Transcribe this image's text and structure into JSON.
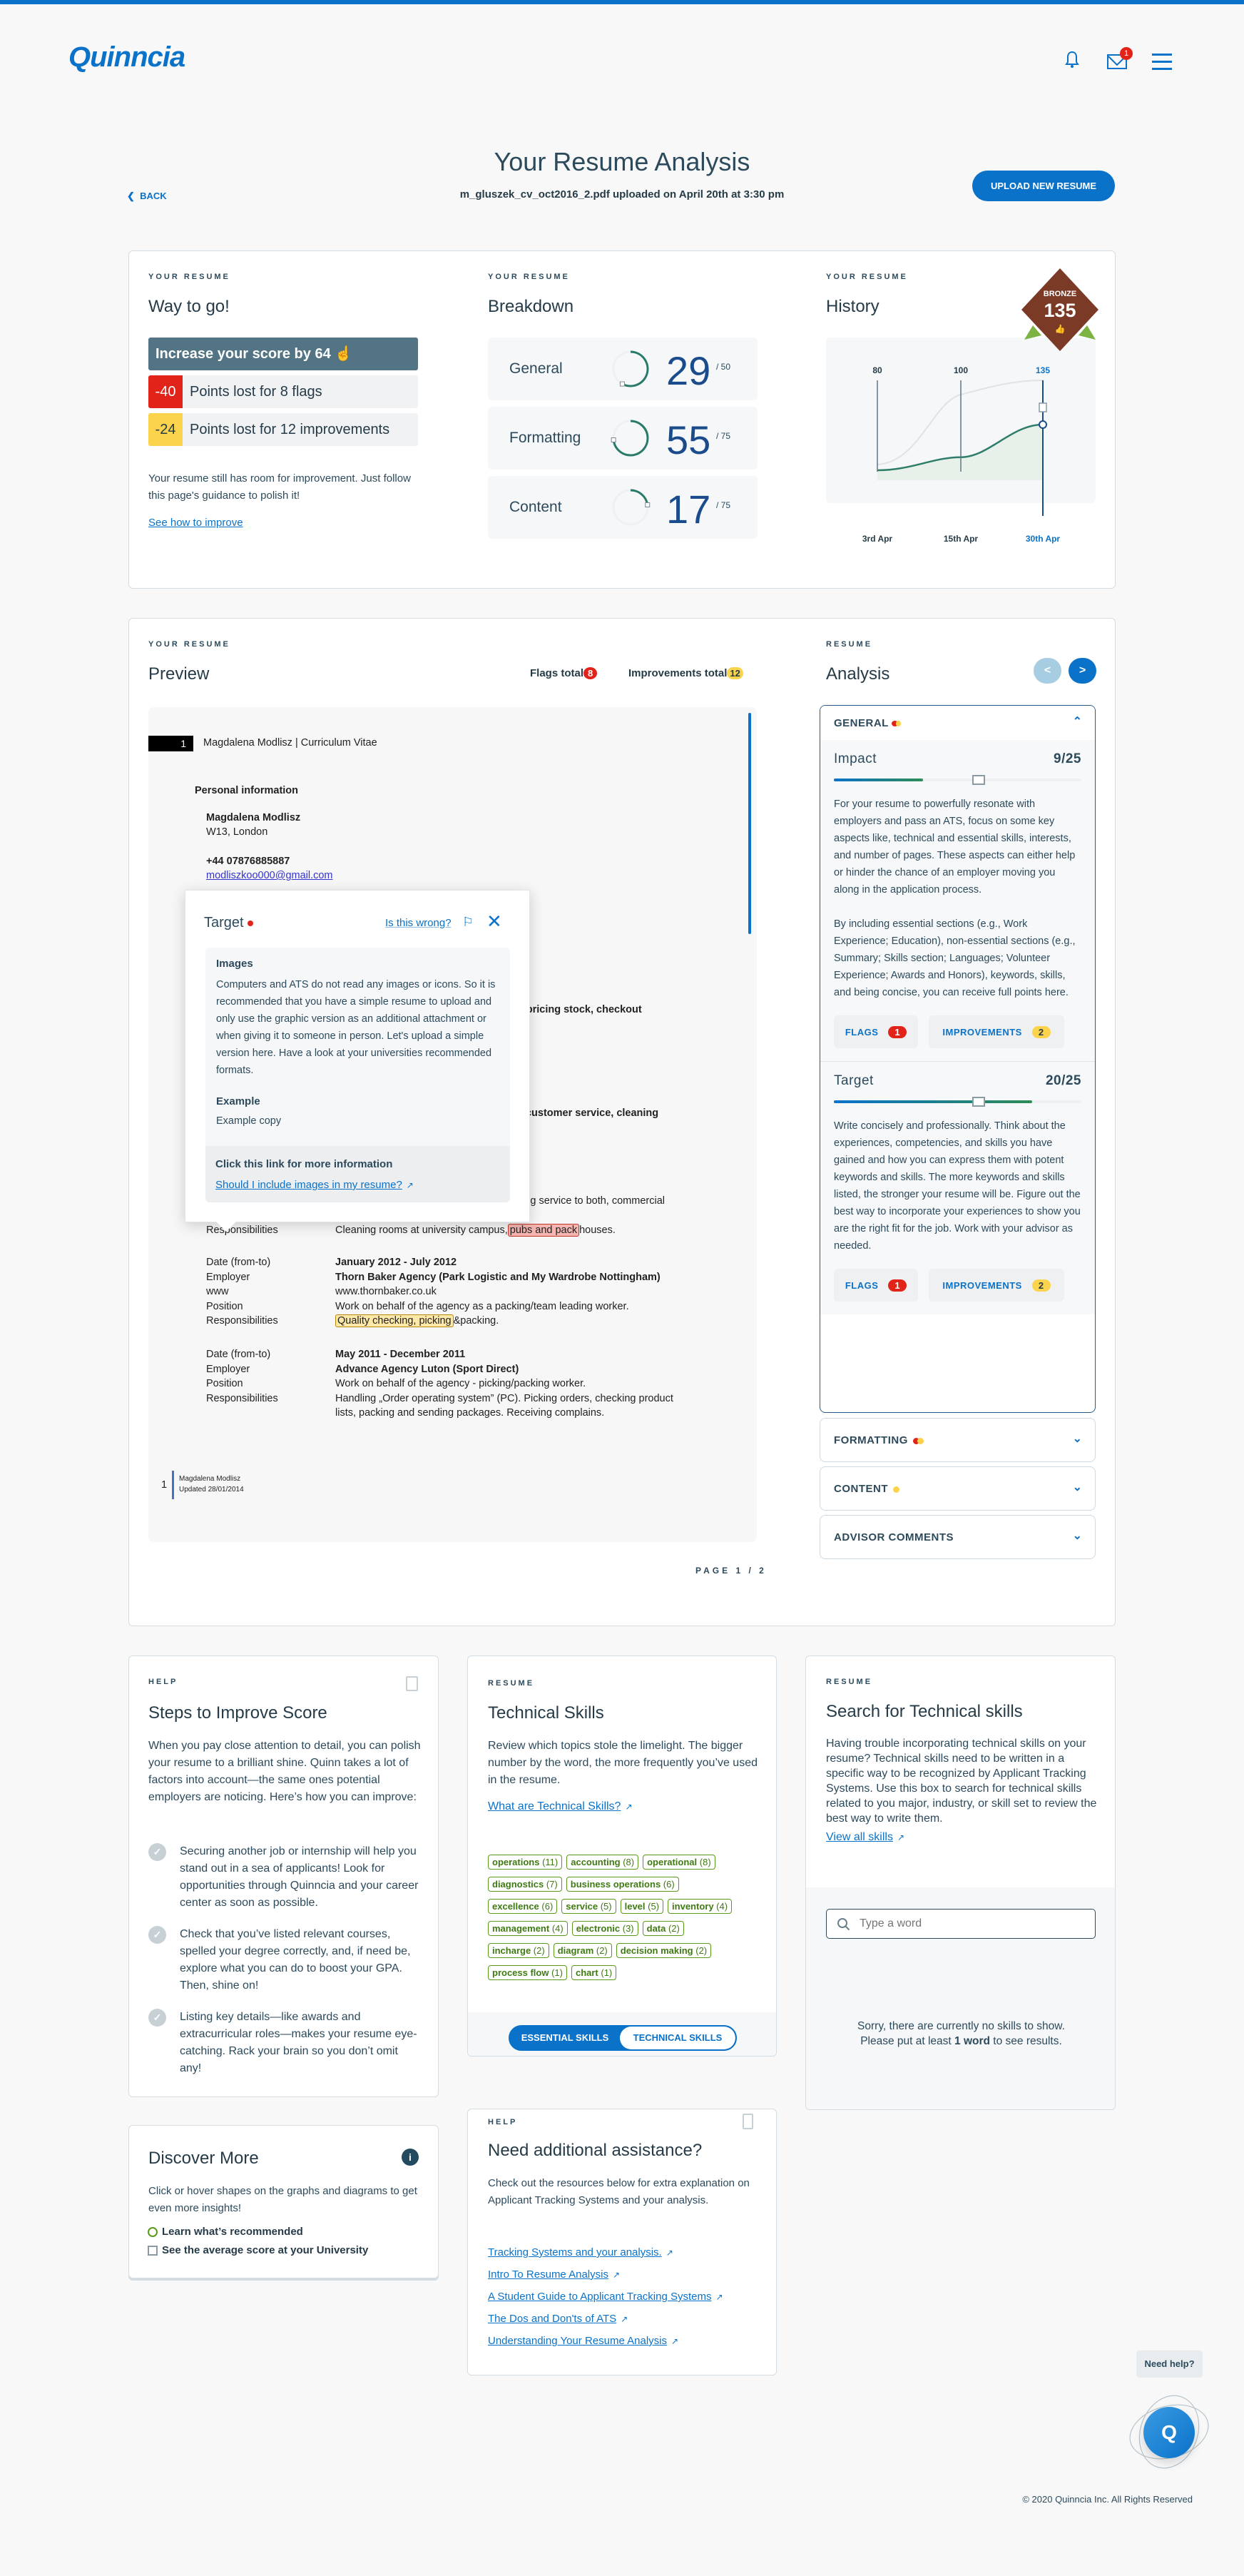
{
  "header": {
    "logo": "Quinncia",
    "mail_badge": "1"
  },
  "page": {
    "title": "Your Resume Analysis",
    "file_info": "m_gluszek_cv_oct2016_2.pdf uploaded on April 20th at 3:30 pm",
    "back_label": "BACK",
    "upload_label": "UPLOAD NEW RESUME"
  },
  "summary": {
    "way": {
      "label": "YOUR RESUME",
      "title": "Way to go!",
      "increase": "Increase your score by 64",
      "flags_points": "-40",
      "flags_text": "Points lost for 8 flags",
      "impr_points": "-24",
      "impr_text": "Points lost for 12 improvements",
      "note": "Your resume still has room for improvement. Just follow this page's guidance to polish it!",
      "link": "See how to improve"
    },
    "breakdown": {
      "label": "YOUR RESUME",
      "title": "Breakdown",
      "items": [
        {
          "name": "General",
          "score": 29,
          "max": 50,
          "max_label": "/ 50"
        },
        {
          "name": "Formatting",
          "score": 55,
          "max": 75,
          "max_label": "/ 75"
        },
        {
          "name": "Content",
          "score": 17,
          "max": 75,
          "max_label": "/ 75"
        }
      ]
    },
    "history": {
      "label": "YOUR RESUME",
      "title": "History",
      "badge_label": "BRONZE",
      "badge_score": "135",
      "points": [
        {
          "value": "80",
          "date": "3rd Apr"
        },
        {
          "value": "100",
          "date": "15th Apr"
        },
        {
          "value": "135",
          "date": "30th Apr"
        }
      ]
    }
  },
  "preview": {
    "label": "YOUR RESUME",
    "title": "Preview",
    "flags_total_label": "Flags total",
    "flags_total": "8",
    "improvements_total_label": "Improvements total",
    "improvements_total": "12",
    "page_indicator": "PAGE 1 / 2",
    "resume": {
      "page_num": "1",
      "header": "Magdalena Modlisz | Curriculum Vitae",
      "section": "Personal information",
      "name": "Magdalena Modlisz",
      "address": "W13, London",
      "phone": "+44 07876885887",
      "email": "modliszkoo000@gmail.com",
      "fragment1": "nd pricing stock, checkout",
      "fragment2": "ar, customer service, cleaning",
      "fragment3": "aning service to both, commercial",
      "resp_label": "Responsibilities",
      "resp_pre": "Cleaning rooms at university campus,",
      "resp_flag": "pubs and pack",
      "resp_post": "houses.",
      "jobs": [
        {
          "rows": [
            {
              "k": "Date (from-to)",
              "v": "January 2012 - July 2012",
              "bold": true
            },
            {
              "k": "Employer",
              "v": "Thorn Baker Agency (Park Logistic and My Wardrobe Nottingham)",
              "bold": true
            },
            {
              "k": "www",
              "v": "www.thornbaker.co.uk"
            },
            {
              "k": "Position",
              "v": "Work on behalf of the agency as a packing/team leading worker."
            },
            {
              "k": "Responsibilities",
              "v": "&packing.",
              "highlight": "Quality checking, picking"
            }
          ]
        },
        {
          "rows": [
            {
              "k": "Date (from-to)",
              "v": "May 2011 - December 2011",
              "bold": true
            },
            {
              "k": "Employer",
              "v": "Advance Agency Luton (Sport Direct)",
              "bold": true
            },
            {
              "k": "Position",
              "v": "Work on behalf of the agency - picking/packing worker."
            },
            {
              "k": "Responsibilities",
              "v": "Handling „Order operating system” (PC). Picking orders, checking product"
            },
            {
              "k": "",
              "v": "lists, packing and sending packages. Receiving complains."
            }
          ]
        }
      ],
      "footer_num": "1",
      "footer_name": "Magdalena Modlisz",
      "footer_updated": "Updated 28/01/2014"
    },
    "popup": {
      "title": "Target",
      "wrong_link": "Is this wrong?",
      "heading": "Images",
      "body": "Computers and ATS do not read any images or icons. So it is recommended that you have a simple resume to upload and only use the graphic version as an additional attachment or when giving it to someone in person. Let's upload a simple version here. Have a look at your universities recommended formats.",
      "example_heading": "Example",
      "example_body": "Example copy",
      "more_heading": "Click this link for more information",
      "more_link": "Should I include images in my resume?"
    }
  },
  "analysis": {
    "label": "RESUME",
    "title": "Analysis",
    "general": {
      "title": "GENERAL",
      "sections": [
        {
          "name": "Impact",
          "score_label": "9/25",
          "score": 9,
          "max": 25,
          "paragraphs": [
            "For your resume to powerfully resonate with employers and pass an ATS, focus on some key aspects like, technical and essential skills, interests, and number of pages. These aspects can either help or hinder the chance of an employer moving you along in the application process.",
            "By including essential sections (e.g., Work Experience; Education), non-essential sections (e.g., Summary; Skills section; Languages; Volunteer Experience; Awards and Honors), keywords, skills, and being concise, you can receive full points here."
          ],
          "flags_label": "FLAGS",
          "flags": "1",
          "impr_label": "IMPROVEMENTS",
          "impr": "2"
        },
        {
          "name": "Target",
          "score_label": "20/25",
          "score": 20,
          "max": 25,
          "paragraphs": [
            "Write concisely and professionally. Think about the experiences, competencies, and skills you have gained and how you can express them with potent keywords and skills. The more keywords and skills listed, the stronger your resume will be. Figure out the best way to incorporate your experiences to show you are the right fit for the job. Work with your advisor as needed."
          ],
          "flags_label": "FLAGS",
          "flags": "1",
          "impr_label": "IMPROVEMENTS",
          "impr": "2"
        }
      ]
    },
    "collapsed": [
      {
        "title": "FORMATTING",
        "dots": [
          "red",
          "yellow"
        ]
      },
      {
        "title": "CONTENT",
        "dots": [
          "yellow"
        ]
      },
      {
        "title": "ADVISOR COMMENTS",
        "dots": []
      }
    ]
  },
  "steps": {
    "label": "HELP",
    "title": "Steps to Improve Score",
    "intro": "When you pay close attention to detail, you can polish your resume to a brilliant shine. Quinn takes a lot of factors into account—the same ones potential employers are noticing. Here’s how you can improve:",
    "items": [
      "Securing another job or internship will help you stand out in a sea of applicants! Look for opportunities through Quinncia and your career center as soon as possible.",
      "Check that you’ve listed relevant courses, spelled your degree correctly, and, if need be, explore what you can do to boost your GPA. Then, shine on!",
      "Listing key details—like awards and extracurricular roles—makes your resume eye-catching. Rack your brain so you don’t omit any!"
    ]
  },
  "tech": {
    "label": "RESUME",
    "title": "Technical Skills",
    "intro": "Review which topics stole the limelight. The bigger number by the word, the more frequently you’ve used in the resume.",
    "link": "What are Technical Skills?",
    "tags": [
      {
        "word": "operations",
        "count": "(11)"
      },
      {
        "word": "accounting",
        "count": "(8)"
      },
      {
        "word": "operational",
        "count": "(8)"
      },
      {
        "word": "diagnostics",
        "count": "(7)"
      },
      {
        "word": "business operations",
        "count": "(6)"
      },
      {
        "word": "excellence",
        "count": "(6)"
      },
      {
        "word": "service",
        "count": "(5)"
      },
      {
        "word": "level",
        "count": "(5)"
      },
      {
        "word": "inventory",
        "count": "(4)"
      },
      {
        "word": "management",
        "count": "(4)"
      },
      {
        "word": "electronic",
        "count": "(3)"
      },
      {
        "word": "data",
        "count": "(2)"
      },
      {
        "word": "incharge",
        "count": "(2)"
      },
      {
        "word": "diagram",
        "count": "(2)"
      },
      {
        "word": "decision making",
        "count": "(2)"
      },
      {
        "word": "process flow",
        "count": "(1)"
      },
      {
        "word": "chart",
        "count": "(1)"
      }
    ],
    "toggle_essential": "ESSENTIAL SKILLS",
    "toggle_technical": "TECHNICAL SKILLS"
  },
  "search": {
    "label": "RESUME",
    "title": "Search for Technical skills",
    "intro": "Having trouble incorporating technical skills on your resume? Technical skills need to be written in a specific way to be recognized by Applicant Tracking Systems. Use this box to search for technical skills related to you major, industry, or skill set to review the best way to write them.",
    "link": "View all skills",
    "placeholder": "Type a word",
    "empty_line1": "Sorry, there are currently no skills to show.",
    "empty_pre": "Please put at least ",
    "empty_bold": "1 word",
    "empty_post": " to see results."
  },
  "discover": {
    "title": "Discover More",
    "text": "Click or hover shapes on the graphs and diagrams to get even more insights!",
    "opt1": "Learn what’s recommended",
    "opt2": "See the average score at your University"
  },
  "assist": {
    "label": "HELP",
    "title": "Need additional assistance?",
    "text": "Check out the resources below for extra explanation on Applicant Tracking Systems and your analysis.",
    "links": [
      "Tracking Systems and your analysis.",
      "Intro To Resume Analysis",
      "A Student Guide to Applicant Tracking Systems",
      "The Dos and Don'ts of ATS",
      "Understanding Your Resume Analysis"
    ]
  },
  "helpbot": {
    "bubble": "Need help?",
    "letter": "Q"
  },
  "footer": {
    "copyright": "© 2020 Quinncia Inc. All Rights Reserved"
  },
  "colors": {
    "accent": "#0a72c9",
    "flag": "#e2231a",
    "improvement": "#fcd34d",
    "skill": "#5a9a1a"
  }
}
